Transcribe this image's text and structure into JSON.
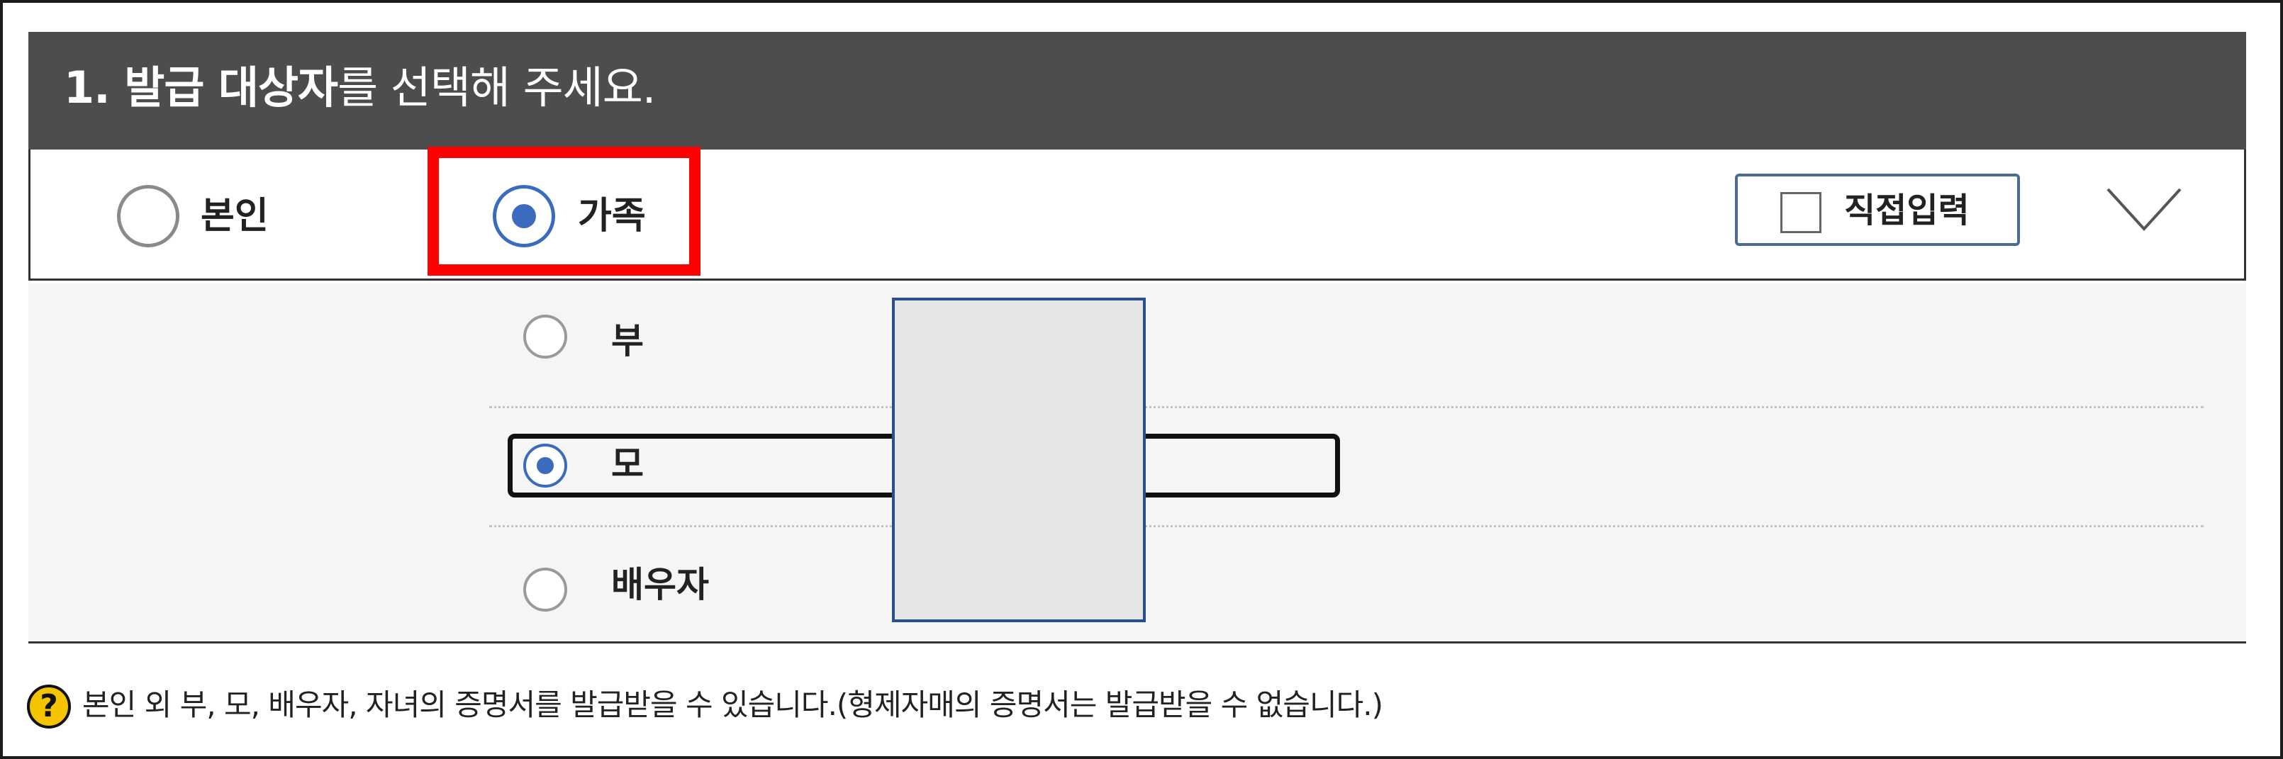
{
  "header": {
    "title_strong": "1. 발급 대상자",
    "title_rest": "를 선택해 주세요."
  },
  "target": {
    "options": [
      {
        "label": "본인",
        "checked": false
      },
      {
        "label": "가족",
        "checked": true
      }
    ],
    "direct_input_label": "직접입력",
    "direct_input_checked": false
  },
  "family": {
    "options": [
      {
        "label": "부",
        "checked": false
      },
      {
        "label": "모",
        "checked": true
      },
      {
        "label": "배우자",
        "checked": false
      }
    ]
  },
  "help": {
    "icon": "question-icon",
    "icon_glyph": "?",
    "text": "본인 외 부, 모, 배우자, 자녀의 증명서를 발급받을 수 있습니다.(형제자매의 증명서는 발급받을 수 없습니다.)"
  },
  "colors": {
    "header_bg": "#4d4d4d",
    "radio_accent": "#3a6bbd",
    "highlight": "#ff0000",
    "help_icon": "#f5c400"
  }
}
